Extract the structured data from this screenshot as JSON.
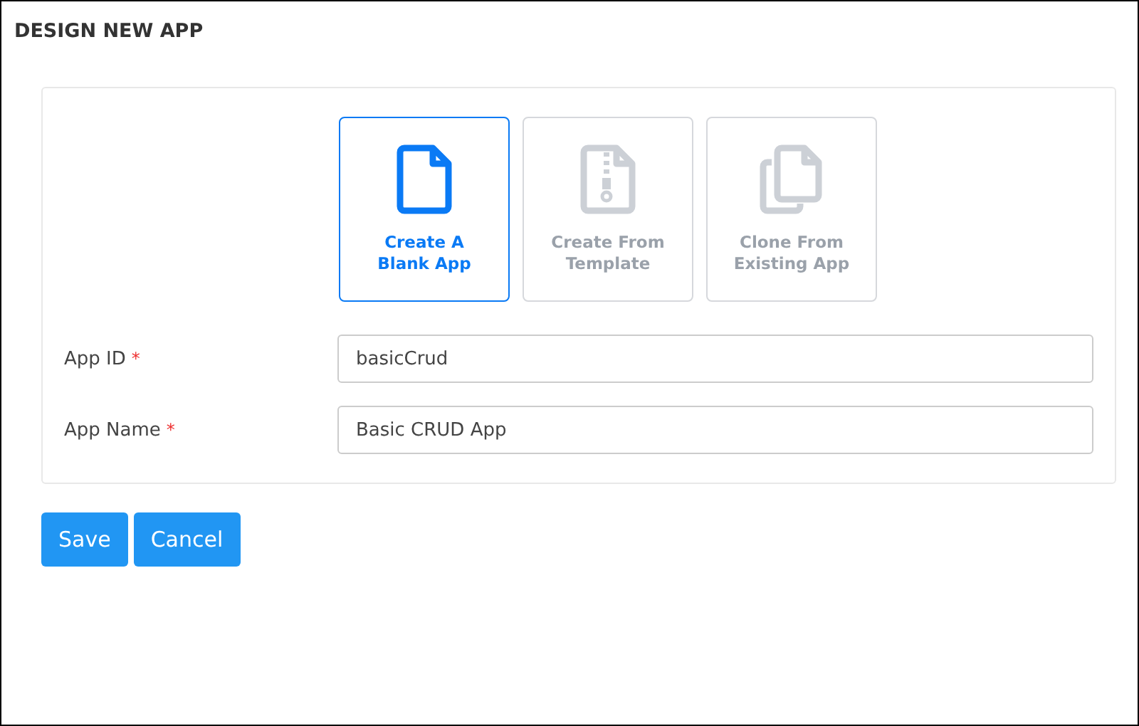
{
  "title": "DESIGN NEW APP",
  "options": [
    {
      "kind": "blank",
      "label": "Create A Blank App",
      "selected": true
    },
    {
      "kind": "template",
      "label": "Create From Template",
      "selected": false
    },
    {
      "kind": "clone",
      "label": "Clone From Existing App",
      "selected": false
    }
  ],
  "fields": [
    {
      "label": "App ID",
      "required": true,
      "value": "basicCrud"
    },
    {
      "label": "App Name",
      "required": true,
      "value": "Basic CRUD App"
    }
  ],
  "required_mark": "*",
  "buttons": [
    "Save",
    "Cancel"
  ]
}
